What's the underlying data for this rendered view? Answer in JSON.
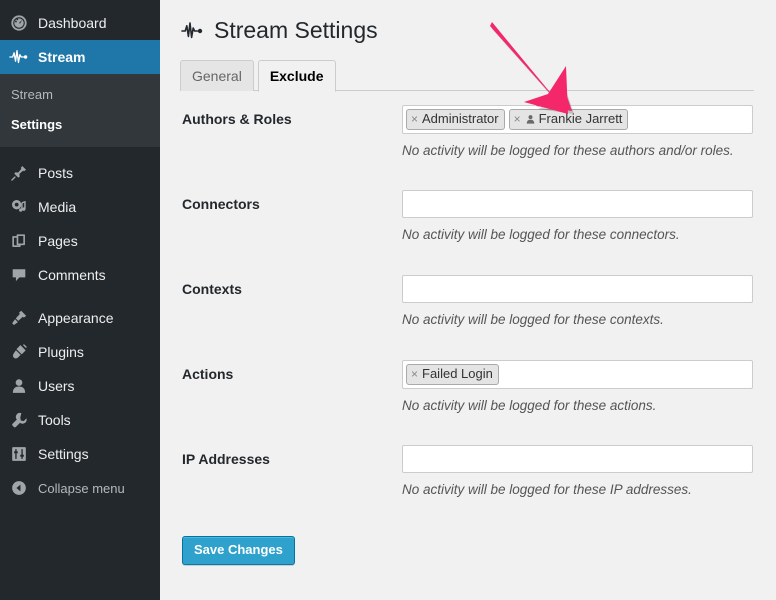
{
  "sidebar": {
    "items": [
      {
        "label": "Dashboard",
        "icon": "dashboard-gauge-icon",
        "name": "dashboard"
      },
      {
        "label": "Stream",
        "icon": "stream-pulse-icon",
        "name": "stream"
      },
      {
        "label": "Posts",
        "icon": "pin-icon",
        "name": "posts"
      },
      {
        "label": "Media",
        "icon": "media-icon",
        "name": "media"
      },
      {
        "label": "Pages",
        "icon": "pages-icon",
        "name": "pages"
      },
      {
        "label": "Comments",
        "icon": "comment-bubble-icon",
        "name": "comments"
      },
      {
        "label": "Appearance",
        "icon": "paintbrush-icon",
        "name": "appearance"
      },
      {
        "label": "Plugins",
        "icon": "plug-icon",
        "name": "plugins"
      },
      {
        "label": "Users",
        "icon": "user-icon",
        "name": "users"
      },
      {
        "label": "Tools",
        "icon": "wrench-icon",
        "name": "tools"
      },
      {
        "label": "Settings",
        "icon": "sliders-icon",
        "name": "settings"
      }
    ],
    "submenu": [
      {
        "label": "Stream",
        "name": "stream",
        "current": false
      },
      {
        "label": "Settings",
        "name": "settings",
        "current": true
      }
    ],
    "collapse": {
      "label": "Collapse menu",
      "icon": "collapse-arrow-icon"
    },
    "active_item": "Stream",
    "colors": {
      "bg": "#23282d",
      "submenu_bg": "#32373c",
      "active_bg": "#1f76a8"
    }
  },
  "header": {
    "title": "Stream Settings",
    "title_icon": "stream-pulse-icon"
  },
  "tabs": [
    {
      "label": "General",
      "name": "general",
      "active": false
    },
    {
      "label": "Exclude",
      "name": "exclude",
      "active": true
    }
  ],
  "form": {
    "rows": [
      {
        "name": "authors-and-roles",
        "label": "Authors & Roles",
        "description": "No activity will be logged for these authors and/or roles.",
        "tags": [
          {
            "label": "Administrator",
            "remove": "×",
            "avatar": false
          },
          {
            "label": "Frankie Jarrett",
            "remove": "×",
            "avatar": true
          }
        ]
      },
      {
        "name": "connectors",
        "label": "Connectors",
        "description": "No activity will be logged for these connectors.",
        "tags": []
      },
      {
        "name": "contexts",
        "label": "Contexts",
        "description": "No activity will be logged for these contexts.",
        "tags": []
      },
      {
        "name": "actions",
        "label": "Actions",
        "description": "No activity will be logged for these actions.",
        "tags": [
          {
            "label": "Failed Login",
            "remove": "×",
            "avatar": false
          }
        ]
      },
      {
        "name": "ip-addresses",
        "label": "IP Addresses",
        "description": "No activity will be logged for these IP addresses.",
        "tags": []
      }
    ],
    "save_button": "Save Changes"
  },
  "annotation": {
    "type": "arrow",
    "color": "#f4276a",
    "points_to": "Frankie Jarrett"
  }
}
